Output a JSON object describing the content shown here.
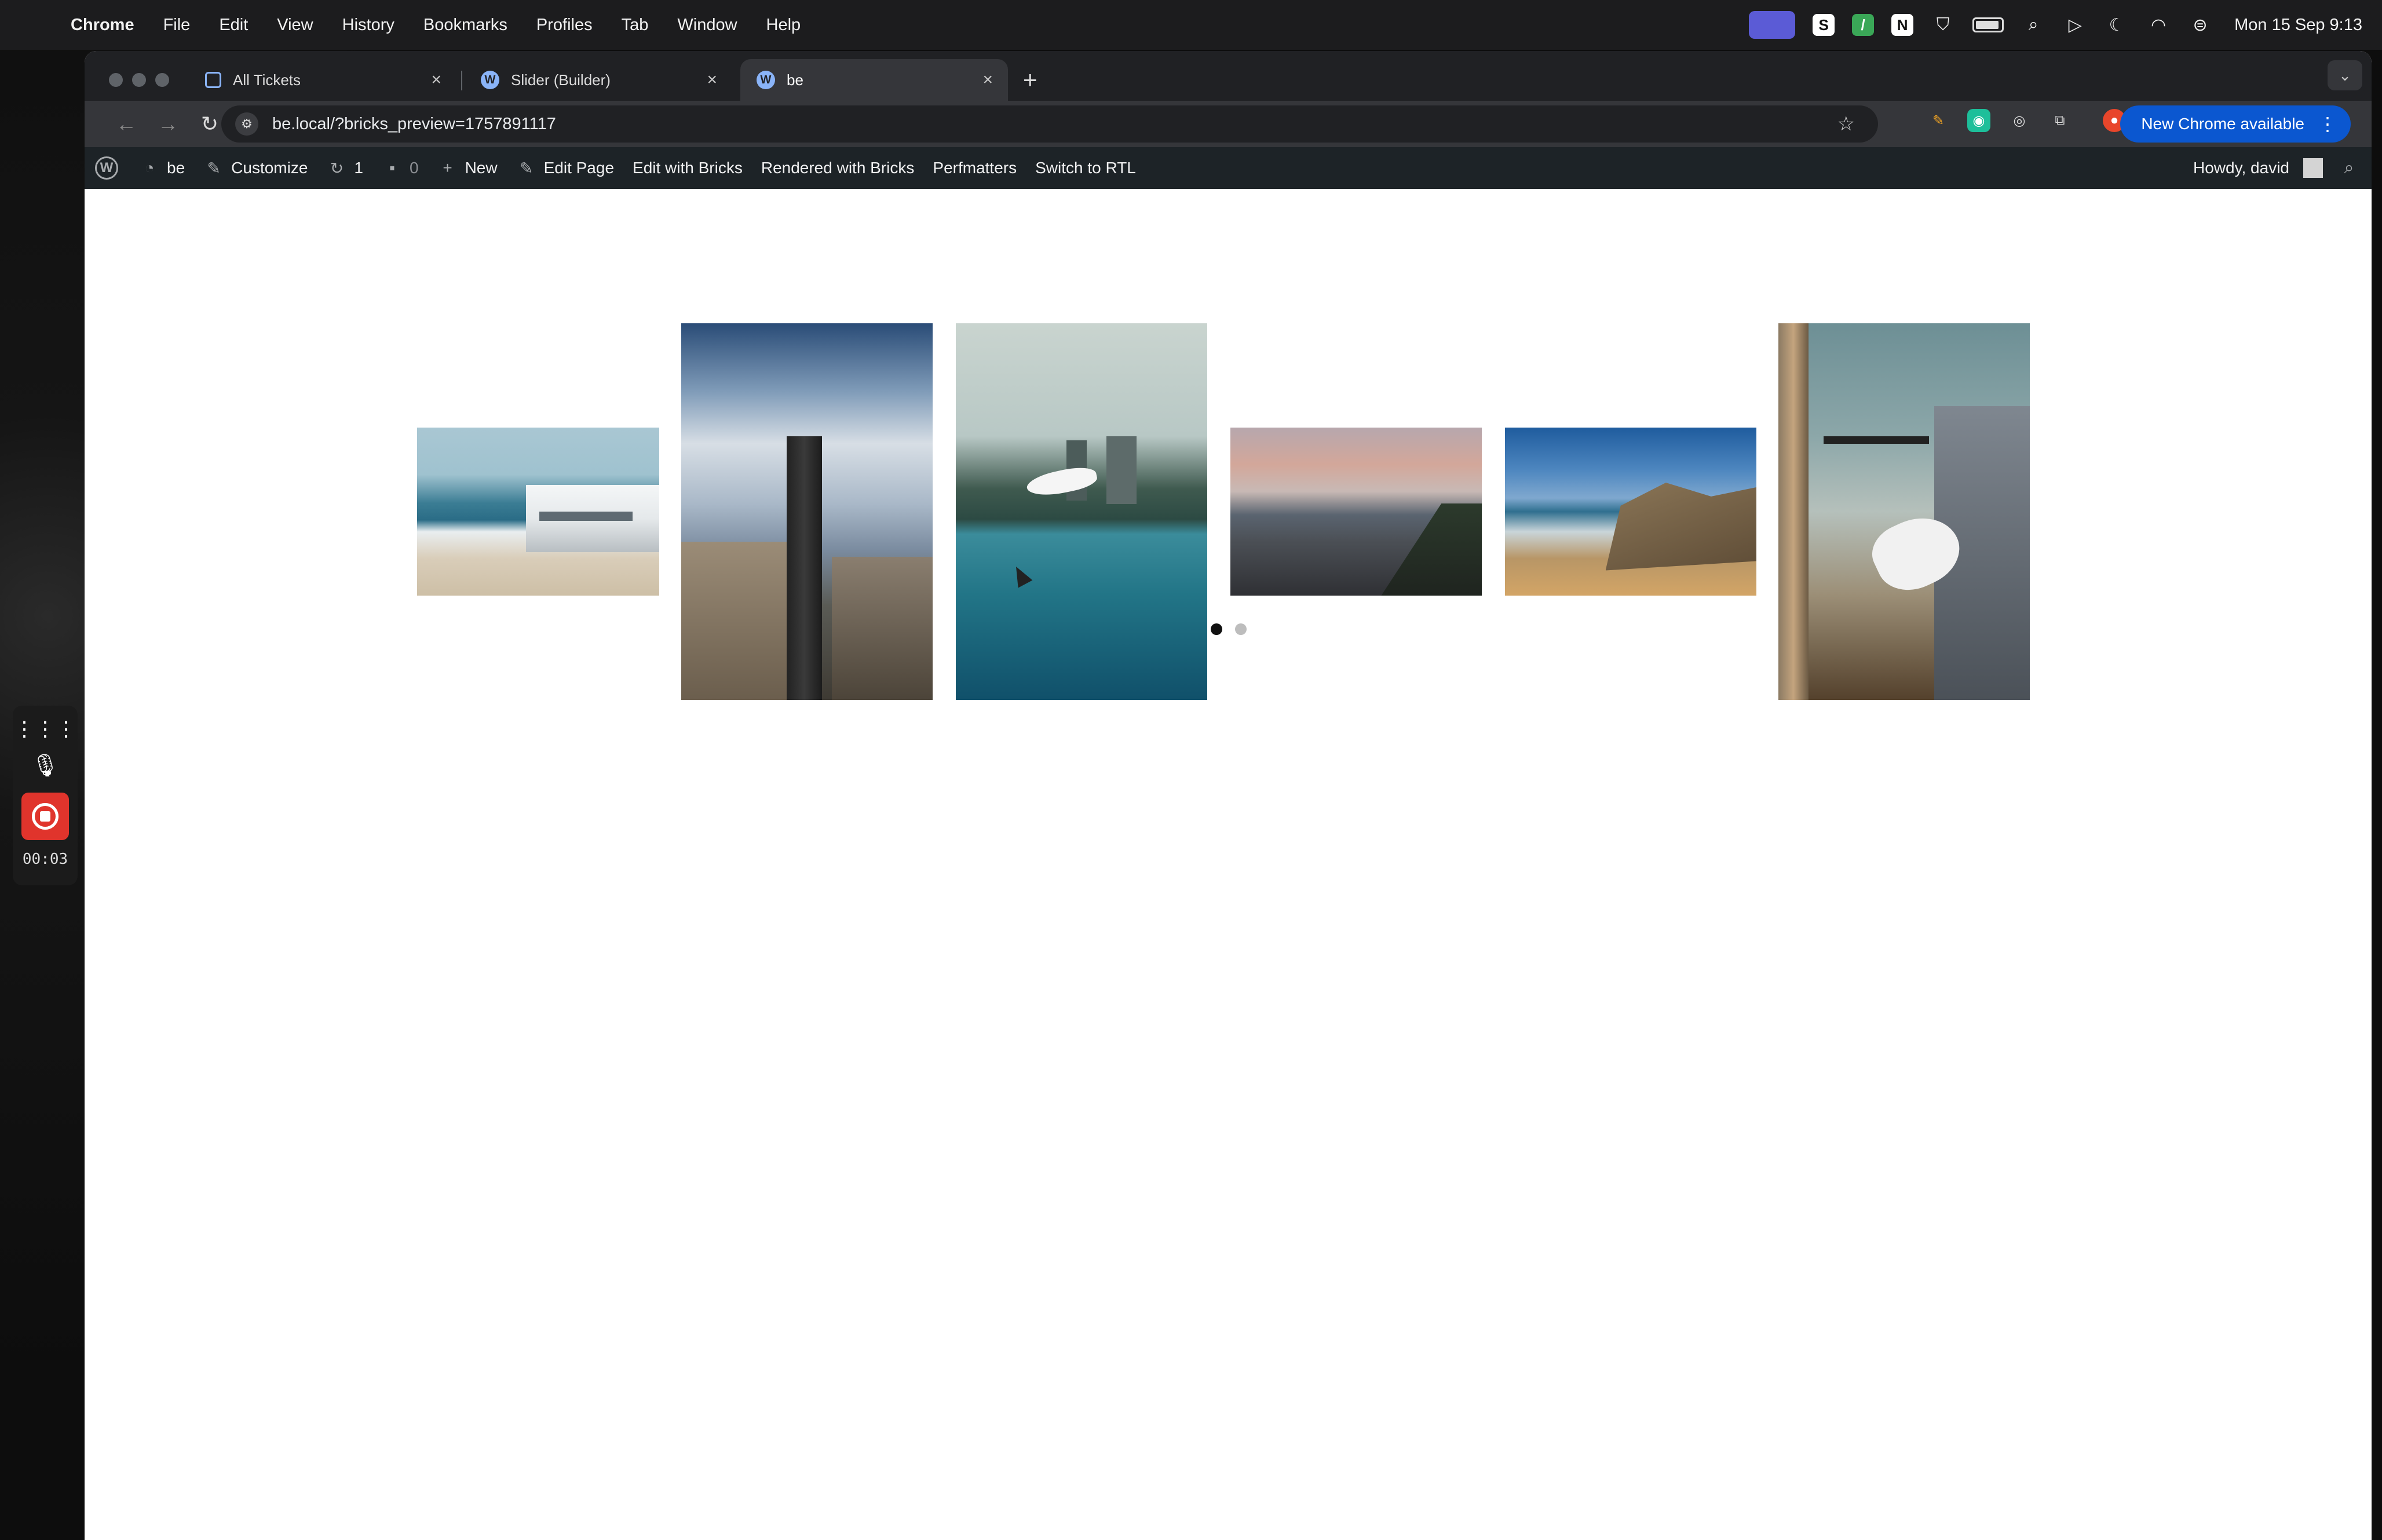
{
  "menubar": {
    "app_name": "Chrome",
    "items": [
      "File",
      "Edit",
      "View",
      "History",
      "Bookmarks",
      "Profiles",
      "Tab",
      "Window",
      "Help"
    ],
    "clock": "Mon 15 Sep  9:13",
    "status_icons": [
      "screen-share-icon",
      "s-app-icon",
      "green-app-icon",
      "notion-icon",
      "shield-icon",
      "battery-icon",
      "spotlight-icon",
      "play-icon",
      "moon-icon",
      "wifi-icon",
      "control-center-icon"
    ]
  },
  "browser": {
    "tabs": [
      {
        "title": "All Tickets",
        "favicon": "ticket-icon",
        "active": false
      },
      {
        "title": "Slider (Builder)",
        "favicon": "wordpress-icon",
        "active": false
      },
      {
        "title": "be",
        "favicon": "wordpress-icon",
        "active": true
      }
    ],
    "new_tab_label": "+",
    "url": "be.local/?bricks_preview=1757891117",
    "new_chrome_label": "New Chrome available"
  },
  "wpbar": {
    "site_name": "be",
    "customize": "Customize",
    "updates_count": "1",
    "comments_count": "0",
    "new_label": "New",
    "edit_page": "Edit Page",
    "edit_with_bricks": "Edit with Bricks",
    "rendered_with_bricks": "Rendered with Bricks",
    "perfmatters": "Perfmatters",
    "switch_rtl": "Switch to RTL",
    "howdy": "Howdy, david"
  },
  "slider": {
    "slides": [
      {
        "subject": "beach-house-image"
      },
      {
        "subject": "skyscraper-image"
      },
      {
        "subject": "lake-bird-image"
      },
      {
        "subject": "harbor-sunset-image"
      },
      {
        "subject": "rocky-coast-image"
      },
      {
        "subject": "seagull-city-image"
      }
    ],
    "pagination": {
      "total": 2,
      "active": 1
    },
    "prev_arrow": "‹"
  },
  "recorder": {
    "timer": "00:03"
  },
  "colors": {
    "wp_admin_bar": "#1d2327",
    "chrome_dark": "#202124",
    "new_chrome_button": "#0b57d0",
    "record_red": "#e0342c"
  }
}
